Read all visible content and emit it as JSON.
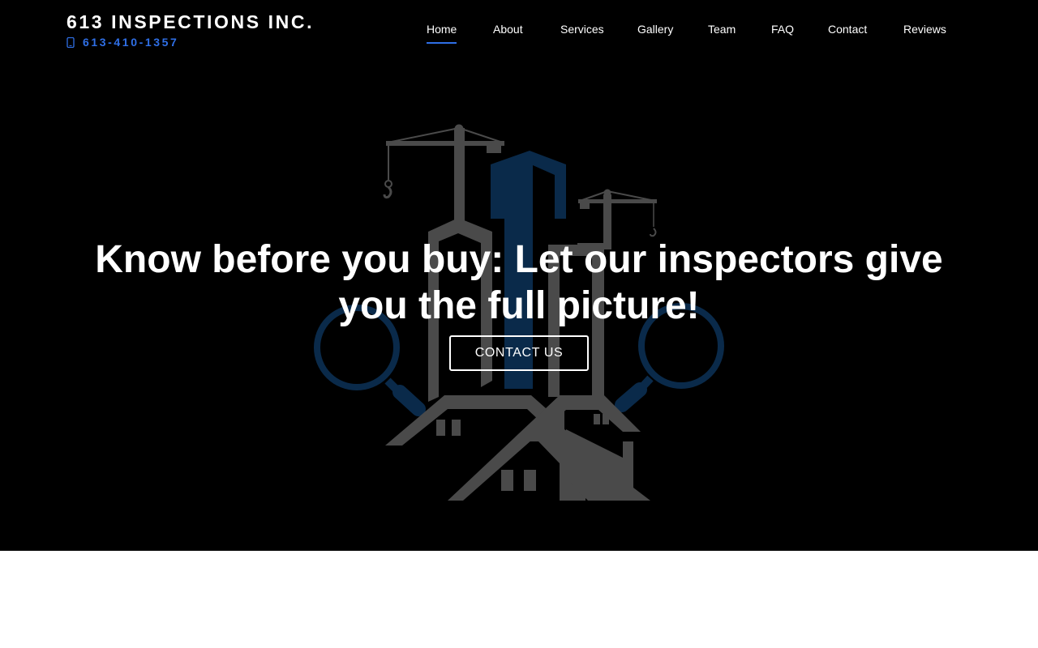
{
  "header": {
    "brand_name": "613 INSPECTIONS INC.",
    "phone": "613-410-1357",
    "phone_icon": "phone-icon"
  },
  "nav": {
    "items": [
      {
        "label": "Home",
        "active": true
      },
      {
        "label": "About"
      },
      {
        "label": "Services"
      },
      {
        "label": "Gallery"
      },
      {
        "label": "Team"
      },
      {
        "label": "FAQ"
      },
      {
        "label": "Contact"
      },
      {
        "label": "Reviews"
      }
    ]
  },
  "hero": {
    "headline": "Know before you buy: Let our inspectors give you the full picture!",
    "cta_label": "CONTACT US",
    "illustration": "buildings-cranes-houses-magnifiers-logo"
  },
  "colors": {
    "background": "#000000",
    "accent": "#2f6fe6",
    "logo_gray": "#4a4a4a",
    "logo_blue": "#0a2a4a",
    "text": "#ffffff",
    "below_fold": "#ffffff"
  }
}
